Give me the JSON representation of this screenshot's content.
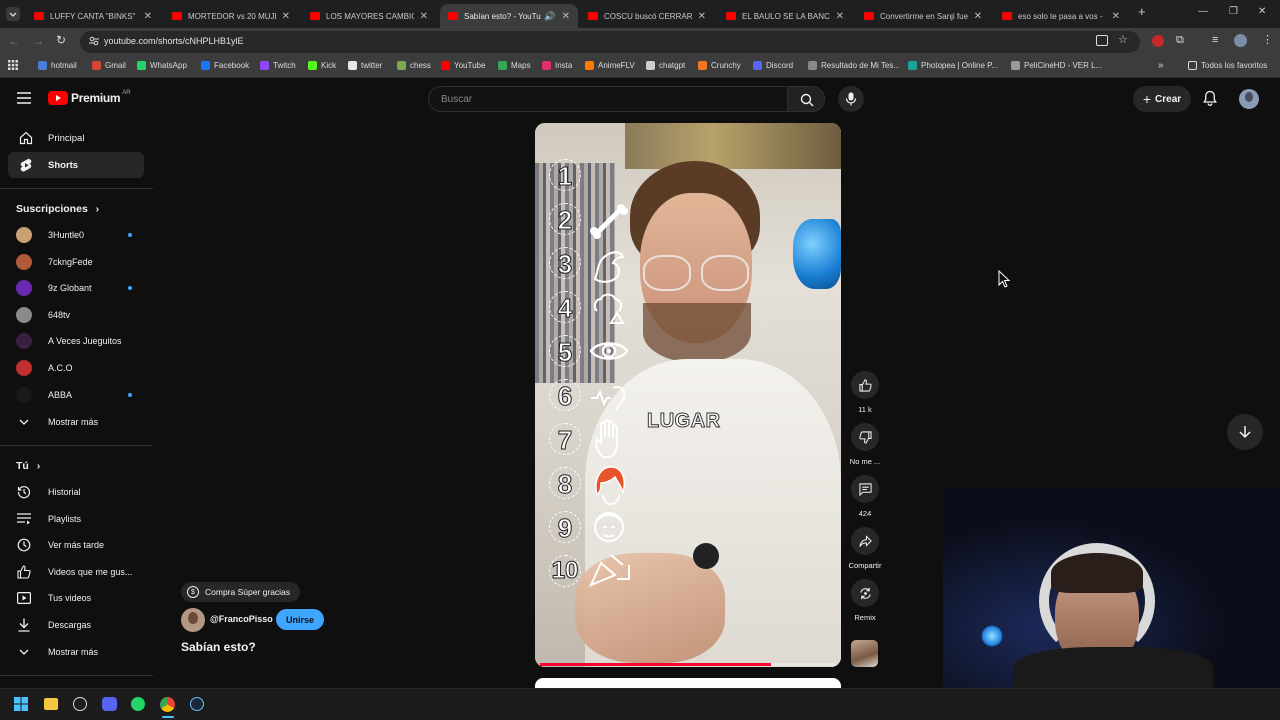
{
  "browser": {
    "tabs": [
      {
        "title": "LUFFY CANTA \"BINKS\" SA"
      },
      {
        "title": "MORTEDOR vs 20 MUJER"
      },
      {
        "title": "LOS MAYORES CAMBIOS"
      },
      {
        "title": "Sabían esto? - YouTub"
      },
      {
        "title": "COSCU buscó CERRAR la"
      },
      {
        "title": "EL BAULO SE LA BANCA"
      },
      {
        "title": "Convertirme en Sanji fue"
      },
      {
        "title": "eso solo te pasa a vos -"
      }
    ],
    "url": "youtube.com/shorts/cNHPLHB1ylE",
    "bookmarks": [
      {
        "label": "hotmail",
        "color": "#4a7fd8"
      },
      {
        "label": "Gmail",
        "color": "#d44638"
      },
      {
        "label": "WhatsApp",
        "color": "#25d366"
      },
      {
        "label": "Facebook",
        "color": "#1877f2"
      },
      {
        "label": "Twitch",
        "color": "#9146ff"
      },
      {
        "label": "Kick",
        "color": "#53fc18"
      },
      {
        "label": "twitter",
        "color": "#e7e7e7"
      },
      {
        "label": "chess",
        "color": "#7fa650"
      },
      {
        "label": "YouTube",
        "color": "#ff0000"
      },
      {
        "label": "Maps",
        "color": "#34a853"
      },
      {
        "label": "Insta",
        "color": "#e1306c"
      },
      {
        "label": "AnimeFLV",
        "color": "#ff7a00"
      },
      {
        "label": "chatgpt",
        "color": "#cccccc"
      },
      {
        "label": "Crunchy",
        "color": "#f47521"
      },
      {
        "label": "Discord",
        "color": "#5865f2"
      },
      {
        "label": "Resultado de Mi Tes...",
        "color": "#888888"
      },
      {
        "label": "Photopea | Online P...",
        "color": "#18a497"
      },
      {
        "label": "PeliCineHD - VER L...",
        "color": "#999999"
      }
    ],
    "all_bookmarks": "Todos los favoritos"
  },
  "header": {
    "logo": "Premium",
    "country": "AR",
    "search_placeholder": "Buscar",
    "create": "Crear"
  },
  "sidebar": {
    "main": [
      {
        "label": "Principal",
        "icon": "home-icon"
      },
      {
        "label": "Shorts",
        "icon": "shorts-icon"
      }
    ],
    "subscriptions_title": "Suscripciones",
    "subscriptions": [
      {
        "name": "3Huntle0",
        "color": "#c9a070",
        "live": true
      },
      {
        "name": "7ckngFede",
        "color": "#b05a3a",
        "live": false
      },
      {
        "name": "9z Globant",
        "color": "#6a2ab3",
        "live": true
      },
      {
        "name": "648tv",
        "color": "#8a8a8a",
        "live": false
      },
      {
        "name": "A Veces Jueguitos",
        "color": "#3a2040",
        "live": false
      },
      {
        "name": "A.C.O",
        "color": "#c03030",
        "live": false
      },
      {
        "name": "ABBA",
        "color": "#1a1a1a",
        "live": true
      }
    ],
    "show_more": "Mostrar más",
    "you_title": "Tú",
    "you_items": [
      {
        "label": "Historial",
        "icon": "history-icon"
      },
      {
        "label": "Playlists",
        "icon": "playlist-icon"
      },
      {
        "label": "Ver más tarde",
        "icon": "clock-icon"
      },
      {
        "label": "Videos que me gus...",
        "icon": "like-icon"
      },
      {
        "label": "Tus videos",
        "icon": "video-icon"
      },
      {
        "label": "Descargas",
        "icon": "download-icon"
      }
    ],
    "show_more_2": "Mostrar más"
  },
  "short": {
    "overlay_word": "LUGAR",
    "numbers": [
      "1",
      "2",
      "3",
      "4",
      "5",
      "6",
      "7",
      "8",
      "9",
      "10"
    ],
    "progress": 0.78,
    "super_thanks": "Compra Súper gracias",
    "channel": "@FrancoPisso",
    "join": "Unirse",
    "title": "Sabían esto?"
  },
  "actions": {
    "likes": "11 k",
    "dislike": "No me ...",
    "comments": "424",
    "share": "Compartir",
    "remix": "Remix"
  }
}
